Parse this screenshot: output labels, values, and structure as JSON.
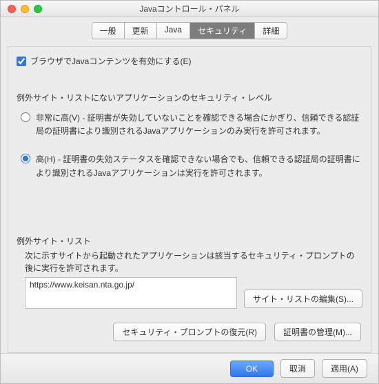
{
  "window": {
    "title": "Javaコントロール・パネル"
  },
  "tabs": {
    "general": "一般",
    "update": "更新",
    "java": "Java",
    "security": "セキュリティ",
    "advanced": "詳細"
  },
  "enableBrowser": "ブラウザでJavaコンテンツを有効にする(E)",
  "secLevelHdr": "例外サイト・リストにないアプリケーションのセキュリティ・レベル",
  "veryHigh": "非常に高(V) - 証明書が失効していないことを確認できる場合にかぎり、信頼できる認証局の証明書により識別されるJavaアプリケーションのみ実行を許可されます。",
  "high": "高(H) - 証明書の失効ステータスを確認できない場合でも、信頼できる認証局の証明書により識別されるJavaアプリケーションは実行を許可されます。",
  "excHdr": "例外サイト・リスト",
  "excDesc": "次に示すサイトから起動されたアプリケーションは該当するセキュリティ・プロンプトの後に実行を許可されます。",
  "sites": {
    "s0": "https://www.keisan.nta.go.jp/"
  },
  "btns": {
    "editSite": "サイト・リストの編集(S)...",
    "restore": "セキュリティ・プロンプトの復元(R)",
    "certs": "証明書の管理(M)...",
    "ok": "OK",
    "cancel": "取消",
    "apply": "適用(A)"
  }
}
